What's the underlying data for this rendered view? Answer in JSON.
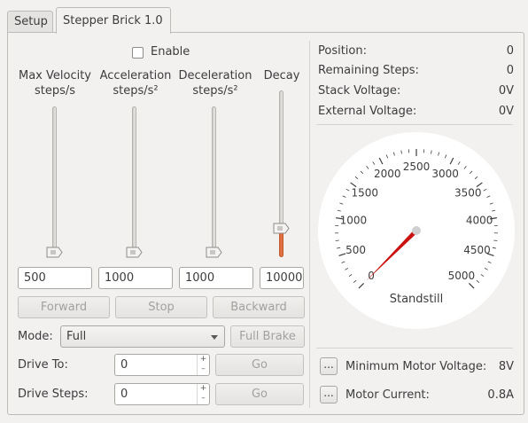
{
  "tabs": [
    {
      "label": "Setup",
      "active": false
    },
    {
      "label": "Stepper Brick 1.0",
      "active": true
    }
  ],
  "enable": {
    "label": "Enable",
    "checked": false
  },
  "sliders": [
    {
      "line1": "Max Velocity",
      "line2": "steps/s",
      "value": "500",
      "level": 0.0
    },
    {
      "line1": "Acceleration",
      "line2": "steps/s²",
      "value": "1000",
      "level": 0.0
    },
    {
      "line1": "Deceleration",
      "line2": "steps/s²",
      "value": "1000",
      "level": 0.0
    },
    {
      "line1": "Decay",
      "line2": "",
      "value": "10000",
      "level": 0.15
    }
  ],
  "buttons": {
    "forward": "Forward",
    "stop": "Stop",
    "backward": "Backward",
    "full_brake": "Full Brake",
    "go": "Go"
  },
  "mode": {
    "label": "Mode:",
    "selected": "Full"
  },
  "drive_to": {
    "label": "Drive To:",
    "value": "0"
  },
  "drive_steps": {
    "label": "Drive Steps:",
    "value": "0"
  },
  "status": {
    "position_label": "Position:",
    "position_value": "0",
    "remaining_label": "Remaining Steps:",
    "remaining_value": "0",
    "stack_label": "Stack Voltage:",
    "stack_value": "0V",
    "external_label": "External Voltage:",
    "external_value": "0V"
  },
  "gauge": {
    "ticks": [
      "0",
      "500",
      "1000",
      "1500",
      "2000",
      "2500",
      "3000",
      "3500",
      "4000",
      "4500",
      "5000"
    ],
    "value": 0,
    "max": 5000,
    "label": "Standstill",
    "needle_color": "#cc1111"
  },
  "min_voltage": {
    "button": "...",
    "label": "Minimum Motor Voltage:",
    "value": "8V"
  },
  "motor_current": {
    "button": "...",
    "label": "Motor Current:",
    "value": "0.8A"
  }
}
